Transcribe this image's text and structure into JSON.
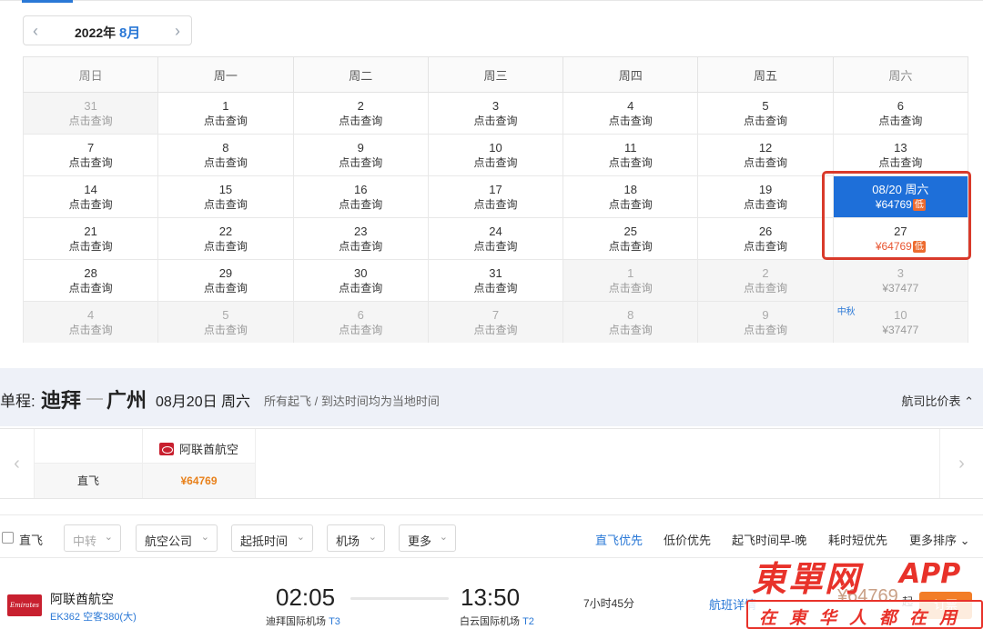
{
  "month_nav": {
    "prev_icon": "‹",
    "year": "2022年",
    "month": "8月",
    "next_icon": "›"
  },
  "calendar": {
    "weekdays": [
      "周日",
      "周一",
      "周二",
      "周三",
      "周四",
      "周五",
      "周六"
    ],
    "query_text": "点击查询",
    "weeks": [
      [
        {
          "day": "31",
          "sub": "点击查询",
          "state": "off"
        },
        {
          "day": "1",
          "sub": "点击查询"
        },
        {
          "day": "2",
          "sub": "点击查询"
        },
        {
          "day": "3",
          "sub": "点击查询"
        },
        {
          "day": "4",
          "sub": "点击查询"
        },
        {
          "day": "5",
          "sub": "点击查询"
        },
        {
          "day": "6",
          "sub": "点击查询"
        }
      ],
      [
        {
          "day": "7",
          "sub": "点击查询"
        },
        {
          "day": "8",
          "sub": "点击查询"
        },
        {
          "day": "9",
          "sub": "点击查询"
        },
        {
          "day": "10",
          "sub": "点击查询"
        },
        {
          "day": "11",
          "sub": "点击查询"
        },
        {
          "day": "12",
          "sub": "点击查询"
        },
        {
          "day": "13",
          "sub": "点击查询"
        }
      ],
      [
        {
          "day": "14",
          "sub": "点击查询"
        },
        {
          "day": "15",
          "sub": "点击查询"
        },
        {
          "day": "16",
          "sub": "点击查询"
        },
        {
          "day": "17",
          "sub": "点击查询"
        },
        {
          "day": "18",
          "sub": "点击查询"
        },
        {
          "day": "19",
          "sub": "点击查询"
        },
        {
          "day": "08/20 周六",
          "price": "¥64769",
          "badge": "低",
          "state": "sel"
        }
      ],
      [
        {
          "day": "21",
          "sub": "点击查询"
        },
        {
          "day": "22",
          "sub": "点击查询"
        },
        {
          "day": "23",
          "sub": "点击查询"
        },
        {
          "day": "24",
          "sub": "点击查询"
        },
        {
          "day": "25",
          "sub": "点击查询"
        },
        {
          "day": "26",
          "sub": "点击查询"
        },
        {
          "day": "27",
          "price": "¥64769",
          "badge": "低"
        }
      ],
      [
        {
          "day": "28",
          "sub": "点击查询"
        },
        {
          "day": "29",
          "sub": "点击查询"
        },
        {
          "day": "30",
          "sub": "点击查询"
        },
        {
          "day": "31",
          "sub": "点击查询"
        },
        {
          "day": "1",
          "sub": "点击查询",
          "state": "off"
        },
        {
          "day": "2",
          "sub": "点击查询",
          "state": "off"
        },
        {
          "day": "3",
          "gray_price": "¥37477",
          "state": "off"
        }
      ],
      [
        {
          "day": "4",
          "sub": "点击查询",
          "state": "off"
        },
        {
          "day": "5",
          "sub": "点击查询",
          "state": "off"
        },
        {
          "day": "6",
          "sub": "点击查询",
          "state": "off"
        },
        {
          "day": "7",
          "sub": "点击查询",
          "state": "off"
        },
        {
          "day": "8",
          "sub": "点击查询",
          "state": "off"
        },
        {
          "day": "9",
          "sub": "点击查询",
          "state": "off"
        },
        {
          "day": "10",
          "gray_price": "¥37477",
          "state": "off",
          "festival": "中秋"
        }
      ]
    ]
  },
  "route": {
    "label": "单程:",
    "from": "迪拜",
    "to": "广州",
    "date": "08月20日 周六",
    "note": "所有起飞 / 到达时间均为当地时间",
    "compare": "航司比价表 ⌃"
  },
  "matrix": {
    "airline": "阿联酋航空",
    "row_label": "直飞",
    "price": "¥64769",
    "left_icon": "‹",
    "right_icon": "›"
  },
  "filters": {
    "direct_label": "直飞",
    "dropdowns": [
      "中转",
      "航空公司",
      "起抵时间",
      "机场",
      "更多"
    ],
    "chevron": "⌄",
    "sorts": [
      "直飞优先",
      "低价优先",
      "起飞时间早-晚",
      "耗时短优先",
      "更多排序 ⌄"
    ]
  },
  "flight": {
    "logo_text": "Emirates",
    "airline": "阿联酋航空",
    "flight_no": "EK362 空客380(大)",
    "dep_time": "02:05",
    "dep_airport": "迪拜国际机场",
    "dep_terminal": "T3",
    "arr_time": "13:50",
    "arr_airport": "白云国际机场",
    "arr_terminal": "T2",
    "duration": "7小时45分",
    "details": "航班详情",
    "price": "¥64769",
    "price_suffix": "起",
    "book": "订票"
  },
  "watermark": {
    "brand": "東單网",
    "app": "APP",
    "slogan": "在東华人都在用"
  },
  "colors": {
    "accent": "#2a78d6",
    "selected_bg": "#1e6fd9",
    "price": "#e8542f",
    "highlight_box": "#d93a2b",
    "book": "#f27d27"
  }
}
